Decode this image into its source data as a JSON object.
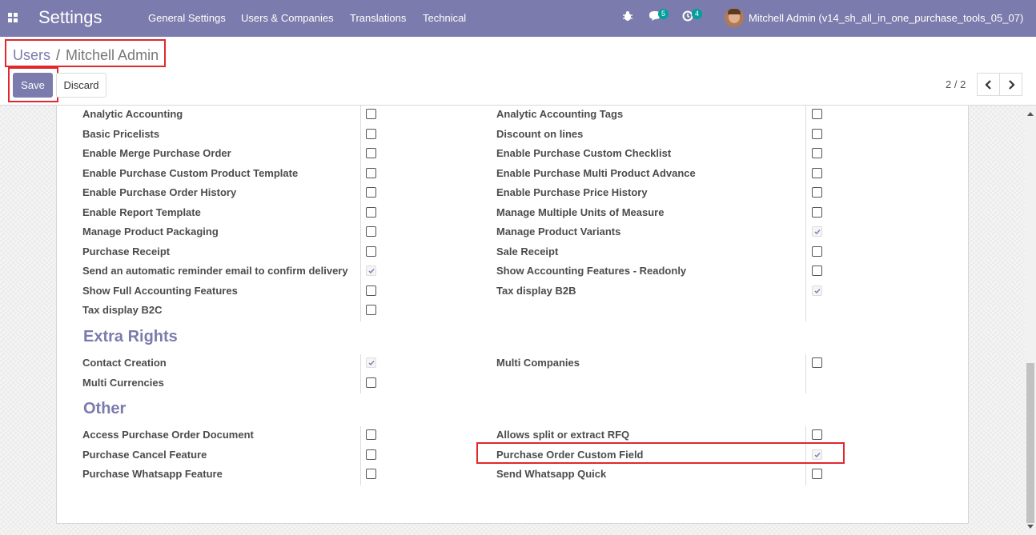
{
  "navbar": {
    "brand": "Settings",
    "menu": [
      "General Settings",
      "Users & Companies",
      "Translations",
      "Technical"
    ],
    "icons": [
      "bug-icon",
      "chat-icon",
      "activity-clock-icon"
    ],
    "chat_count": "5",
    "activity_count": "4",
    "user": "Mitchell Admin (v14_sh_all_in_one_purchase_tools_05_07)"
  },
  "breadcrumb": {
    "parent": "Users",
    "separator": "/",
    "current": "Mitchell Admin"
  },
  "actions": {
    "save": "Save",
    "discard": "Discard"
  },
  "pager": {
    "value": "2 / 2"
  },
  "colors": {
    "accent": "#7c7bad",
    "highlight": "#e0282e",
    "badge": "#00a09d"
  },
  "rights": [
    {
      "left": {
        "label": "Analytic Accounting",
        "checked": false
      },
      "right": {
        "label": "Analytic Accounting Tags",
        "checked": false
      }
    },
    {
      "left": {
        "label": "Basic Pricelists",
        "checked": false
      },
      "right": {
        "label": "Discount on lines",
        "checked": false
      }
    },
    {
      "left": {
        "label": "Enable Merge Purchase Order",
        "checked": false
      },
      "right": {
        "label": "Enable Purchase Custom Checklist",
        "checked": false
      }
    },
    {
      "left": {
        "label": "Enable Purchase Custom Product Template",
        "checked": false
      },
      "right": {
        "label": "Enable Purchase Multi Product Advance",
        "checked": false
      }
    },
    {
      "left": {
        "label": "Enable Purchase Order History",
        "checked": false
      },
      "right": {
        "label": "Enable Purchase Price History",
        "checked": false
      }
    },
    {
      "left": {
        "label": "Enable Report Template",
        "checked": false
      },
      "right": {
        "label": "Manage Multiple Units of Measure",
        "checked": false
      }
    },
    {
      "left": {
        "label": "Manage Product Packaging",
        "checked": false
      },
      "right": {
        "label": "Manage Product Variants",
        "checked": true
      }
    },
    {
      "left": {
        "label": "Purchase Receipt",
        "checked": false
      },
      "right": {
        "label": "Sale Receipt",
        "checked": false
      }
    },
    {
      "left": {
        "label": "Send an automatic reminder email to confirm delivery",
        "checked": true
      },
      "right": {
        "label": "Show Accounting Features - Readonly",
        "checked": false
      }
    },
    {
      "left": {
        "label": "Show Full Accounting Features",
        "checked": false
      },
      "right": {
        "label": "Tax display B2B",
        "checked": true
      }
    },
    {
      "left": {
        "label": "Tax display B2C",
        "checked": false
      },
      "right": null
    }
  ],
  "extra_rights": {
    "title": "Extra Rights",
    "rows": [
      {
        "left": {
          "label": "Contact Creation",
          "checked": true
        },
        "right": {
          "label": "Multi Companies",
          "checked": false
        }
      },
      {
        "left": {
          "label": "Multi Currencies",
          "checked": false
        },
        "right": null
      }
    ]
  },
  "other": {
    "title": "Other",
    "rows": [
      {
        "left": {
          "label": "Access Purchase Order Document",
          "checked": false
        },
        "right": {
          "label": "Allows split or extract RFQ",
          "checked": false
        }
      },
      {
        "left": {
          "label": "Purchase Cancel Feature",
          "checked": false
        },
        "right": {
          "label": "Purchase Order Custom Field",
          "checked": true
        }
      },
      {
        "left": {
          "label": "Purchase Whatsapp Feature",
          "checked": false
        },
        "right": {
          "label": "Send Whatsapp Quick",
          "checked": false
        }
      }
    ]
  }
}
